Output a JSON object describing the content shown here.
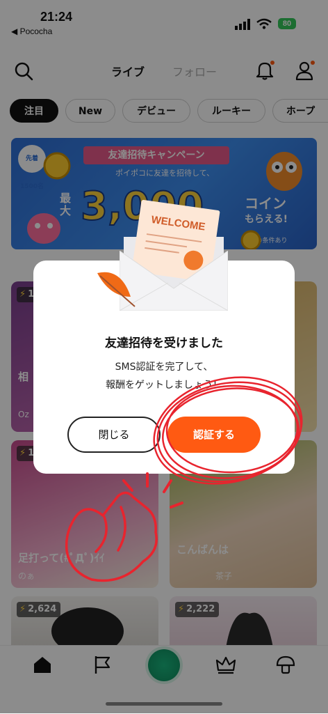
{
  "status_bar": {
    "time": "21:24",
    "back_app": "◀ Pococha",
    "battery": "80"
  },
  "header": {
    "tabs": [
      {
        "label": "ライブ"
      },
      {
        "label": "フォロー"
      }
    ]
  },
  "filter_chips": [
    {
      "label": "注目"
    },
    {
      "label": "New"
    },
    {
      "label": "デビュー"
    },
    {
      "label": "ルーキー"
    },
    {
      "label": "ホープ"
    }
  ],
  "banner": {
    "badge": "先着1500名",
    "title": "友達招待キャンペーン",
    "subtitle": "ポイポコに友達を招待して、",
    "max_label": "最大",
    "amount": "3,000",
    "unit": "コイン",
    "get": "もらえる!",
    "note": "※条件あり"
  },
  "cards": [
    {
      "count": "1",
      "title": "相",
      "user": "Oz"
    },
    {
      "count": "",
      "title": "",
      "user": ""
    },
    {
      "count": "1",
      "title": "足打って(#ﾟДﾟ)ｲｲ",
      "user": "のぁ"
    },
    {
      "count": "",
      "title": "こんばんは",
      "user": "茶子"
    },
    {
      "count": "2,624",
      "title": "",
      "user": ""
    },
    {
      "count": "2,222",
      "title": "",
      "user": ""
    }
  ],
  "dialog": {
    "image_text": "WELCOME",
    "title": "友達招待を受けました",
    "message_line1": "SMS認証を完了して、",
    "message_line2": "報酬をゲットしましょう！",
    "close_label": "閉じる",
    "verify_label": "認証する"
  },
  "colors": {
    "accent": "#ff5a12",
    "live_button": "#1ab67e",
    "banner_blue": "#2f6fd6",
    "annotation_red": "#e8242e"
  }
}
